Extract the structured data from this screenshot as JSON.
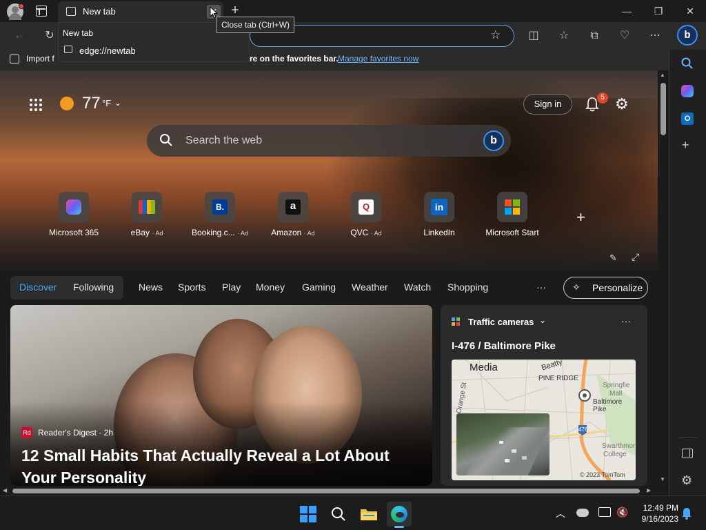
{
  "browser": {
    "tab_title": "New tab",
    "tooltip": "Close tab (Ctrl+W)",
    "dropdown_title": "New tab",
    "dropdown_url": "edge://newtab",
    "favbar_import": "Import f",
    "favbar_hint": "re on the favorites bar.",
    "favbar_link": "Manage favorites now"
  },
  "newtab": {
    "temperature": "77",
    "unit": "°F",
    "sign_in": "Sign in",
    "notification_count": "5",
    "search_placeholder": "Search the web",
    "quick_links": [
      {
        "label": "Microsoft 365",
        "ad": ""
      },
      {
        "label": "eBay",
        "ad": "· Ad"
      },
      {
        "label": "Booking.c...",
        "ad": "· Ad"
      },
      {
        "label": "Amazon",
        "ad": "· Ad"
      },
      {
        "label": "QVC",
        "ad": "· Ad"
      },
      {
        "label": "LinkedIn",
        "ad": ""
      },
      {
        "label": "Microsoft Start",
        "ad": ""
      }
    ],
    "nav": {
      "discover": "Discover",
      "following": "Following",
      "items": [
        "News",
        "Sports",
        "Play",
        "Money",
        "Gaming",
        "Weather",
        "Watch",
        "Shopping"
      ],
      "more": "···",
      "personalize": "Personalize"
    },
    "main_card": {
      "source": "Reader's Digest · 2h",
      "source_logo": "Rd",
      "headline": "12 Small Habits That Actually Reveal a Lot About Your Personality"
    },
    "side_card": {
      "header": "Traffic cameras",
      "location": "I-476 / Baltimore Pike",
      "map_labels": {
        "media": "Media",
        "beatty": "Beatty",
        "pine_ridge": "PINE RIDGE",
        "springfield": "Springfie",
        "mall": "Mall",
        "baltimore_pike": "Baltimore Pike",
        "swarthmore": "Swarthmor",
        "college": "College",
        "orange_st": "Orange St",
        "route": "476",
        "copyright": "© 2023 TomTom"
      },
      "more": "···"
    }
  },
  "taskbar": {
    "time": "12:49 PM",
    "date": "9/16/2023"
  },
  "colors": {
    "accent": "#4aa4f5",
    "link": "#6cb4ff",
    "badge": "#e2462b",
    "sun": "#f59a22"
  }
}
